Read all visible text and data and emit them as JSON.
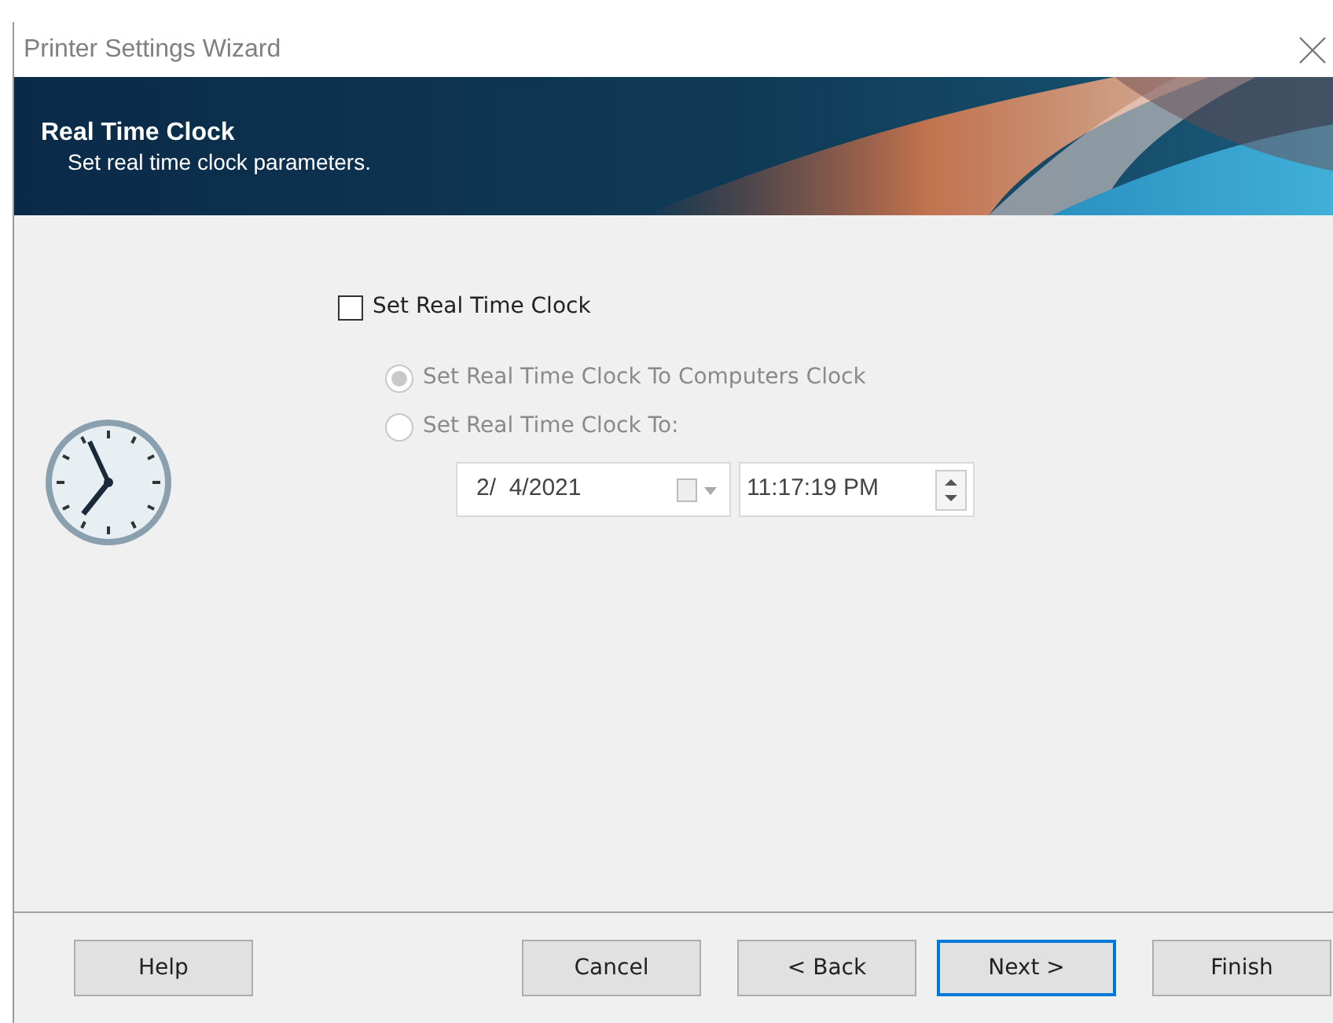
{
  "window": {
    "title": "Printer Settings Wizard"
  },
  "header": {
    "title": "Real Time Clock",
    "subtitle": "Set real time clock parameters."
  },
  "set_clock": {
    "label": "Set Real Time Clock",
    "checked": false
  },
  "options": [
    {
      "label": "Set Real Time Clock To Computers Clock",
      "selected": true,
      "disabled": true
    },
    {
      "label": "Set Real Time Clock To:",
      "selected": false,
      "disabled": true
    }
  ],
  "date": {
    "value": "2/  4/2021"
  },
  "time": {
    "value": "11:17:19 PM"
  },
  "buttons": [
    {
      "label": "Help",
      "default": false
    },
    {
      "label": "Cancel",
      "default": false
    },
    {
      "label": "< Back",
      "default": false
    },
    {
      "label": "Next >",
      "default": true
    },
    {
      "label": "Finish",
      "default": false
    }
  ]
}
